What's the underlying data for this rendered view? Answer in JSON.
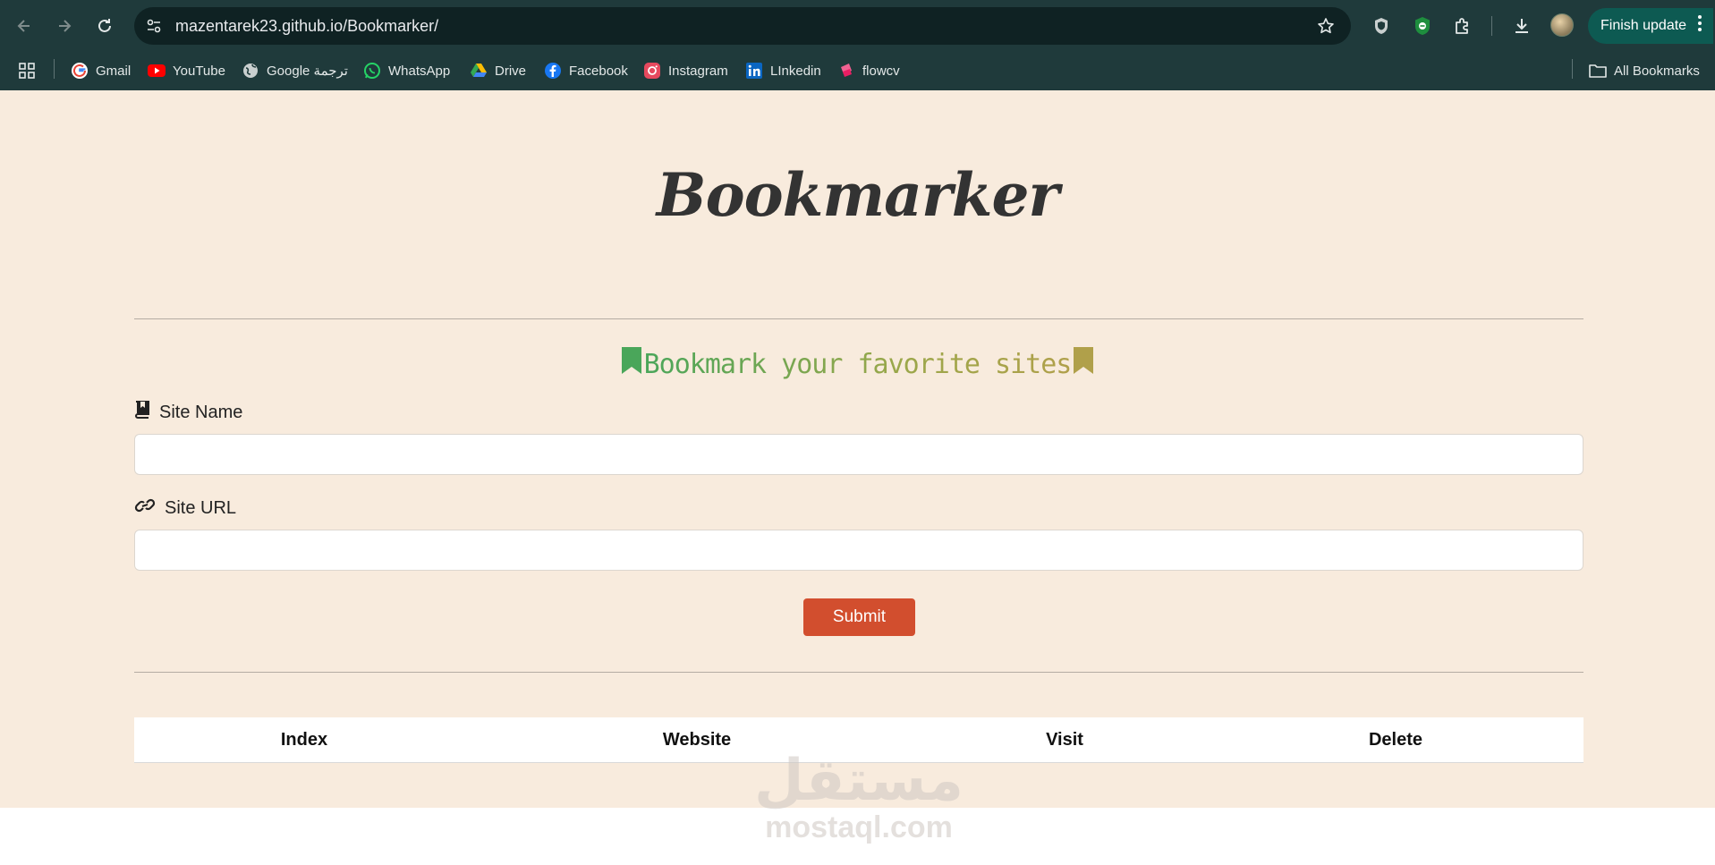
{
  "browser": {
    "url": "mazentarek23.github.io/Bookmarker/",
    "finish_update_label": "Finish update",
    "bookmarks": [
      {
        "label": "Gmail",
        "icon": "gmail-icon"
      },
      {
        "label": "YouTube",
        "icon": "youtube-icon"
      },
      {
        "label": "Google ترجمة",
        "icon": "globe-icon"
      },
      {
        "label": "WhatsApp",
        "icon": "whatsapp-icon"
      },
      {
        "label": "Drive",
        "icon": "drive-icon"
      },
      {
        "label": "Facebook",
        "icon": "facebook-icon"
      },
      {
        "label": "Instagram",
        "icon": "instagram-icon"
      },
      {
        "label": "LInkedin",
        "icon": "linkedin-icon"
      },
      {
        "label": "flowcv",
        "icon": "flowcv-icon"
      }
    ],
    "all_bookmarks_label": "All Bookmarks"
  },
  "page": {
    "title": "Bookmarker",
    "subtitle": "Bookmark your favorite sites",
    "site_name_label": "Site Name",
    "site_url_label": "Site URL",
    "site_name_value": "",
    "site_url_value": "",
    "submit_label": "Submit",
    "table_headers": [
      "Index",
      "Website",
      "Visit",
      "Delete"
    ]
  },
  "watermark": {
    "arabic": "مستقل",
    "latin": "mostaql.com"
  },
  "colors": {
    "page_bg": "#f8ebdd",
    "chrome_bg": "#1f3a3b",
    "submit_bg": "#d24e2e",
    "subtitle_green": "#4aa65a",
    "subtitle_gold": "#b0a04a",
    "finish_update_bg": "#0d5a52"
  }
}
